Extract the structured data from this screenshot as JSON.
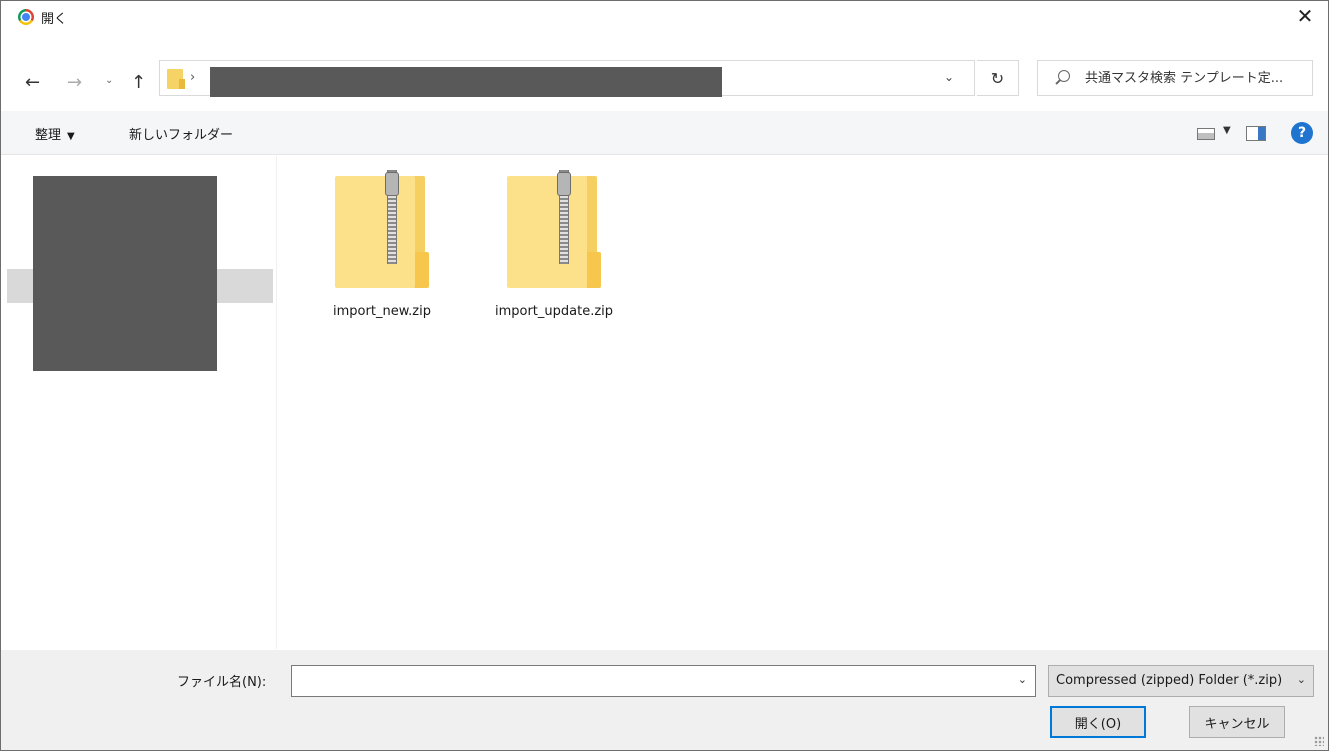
{
  "window": {
    "title": "開く",
    "close_symbol": "✕"
  },
  "nav": {
    "back_symbol": "←",
    "forward_symbol": "→",
    "recent_symbol": "⌄",
    "up_symbol": "↑",
    "path_chevron": "›",
    "address_dropdown_symbol": "⌄",
    "refresh_symbol": "↻",
    "search_placeholder": "共通マスタ検索 テンプレート定..."
  },
  "commandbar": {
    "organize_label": "整理",
    "organize_caret": "▼",
    "new_folder_label": "新しいフォルダー",
    "view_caret": "▼",
    "help_symbol": "?"
  },
  "files": [
    {
      "name": "import_new.zip",
      "type": "zip"
    },
    {
      "name": "import_update.zip",
      "type": "zip"
    }
  ],
  "bottom": {
    "filename_label": "ファイル名(N):",
    "filename_value": "",
    "filename_dropdown_symbol": "⌄",
    "filetype_label": "Compressed (zipped) Folder (*.zip)",
    "filetype_dropdown_symbol": "⌄",
    "open_label": "開く(O)",
    "cancel_label": "キャンセル"
  },
  "colors": {
    "accent": "#0078d7",
    "folder": "#fde08a",
    "redaction": "#595959"
  },
  "icons": {
    "app": "chrome-icon",
    "folder": "folder-icon",
    "search": "search-icon",
    "view": "view-options-icon",
    "preview": "preview-pane-icon",
    "help": "help-icon",
    "file": "zip-folder-icon"
  }
}
